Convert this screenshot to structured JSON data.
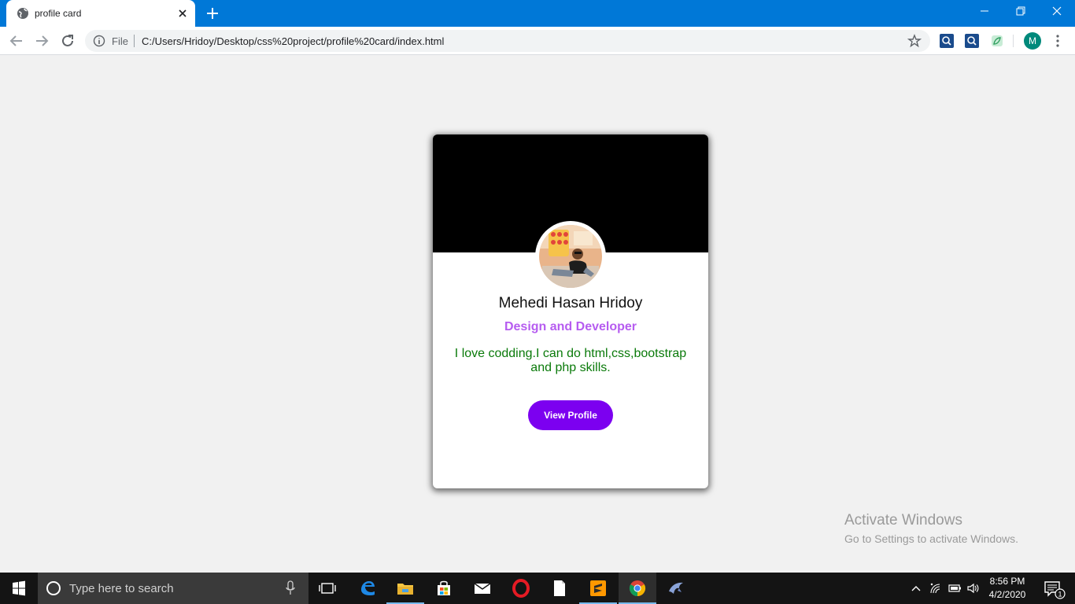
{
  "browser": {
    "tab_title": "profile card",
    "address": {
      "scheme_label": "File",
      "url": "C:/Users/Hridoy/Desktop/css%20project/profile%20card/index.html"
    },
    "profile_initial": "M",
    "icons": {
      "tab_favicon": "globe-icon",
      "tab_close": "close-icon",
      "new_tab": "plus-icon",
      "back": "arrow-left-icon",
      "forward": "arrow-right-icon",
      "reload": "reload-icon",
      "site_info": "info-icon",
      "bookmark": "star-icon",
      "menu": "kebab-menu-icon"
    }
  },
  "card": {
    "name": "Mehedi Hasan Hridoy",
    "role": "Design and Developer",
    "bio": "I love codding.I can do html,css,bootstrap and php skills.",
    "button_label": "View Profile",
    "colors": {
      "cover": "#000000",
      "role": "#b65cf0",
      "bio": "#0a7a0a",
      "button": "#7c00f0"
    }
  },
  "watermark": {
    "title": "Activate Windows",
    "subtitle": "Go to Settings to activate Windows."
  },
  "taskbar": {
    "search_placeholder": "Type here to search",
    "apps": [
      "task-view-icon",
      "edge-icon",
      "file-explorer-icon",
      "store-icon",
      "mail-icon",
      "opera-icon",
      "notepad-icon",
      "sublime-text-icon",
      "chrome-icon",
      "dolphin-icon"
    ],
    "time": "8:56 PM",
    "date": "4/2/2020",
    "notification_count": "1"
  }
}
